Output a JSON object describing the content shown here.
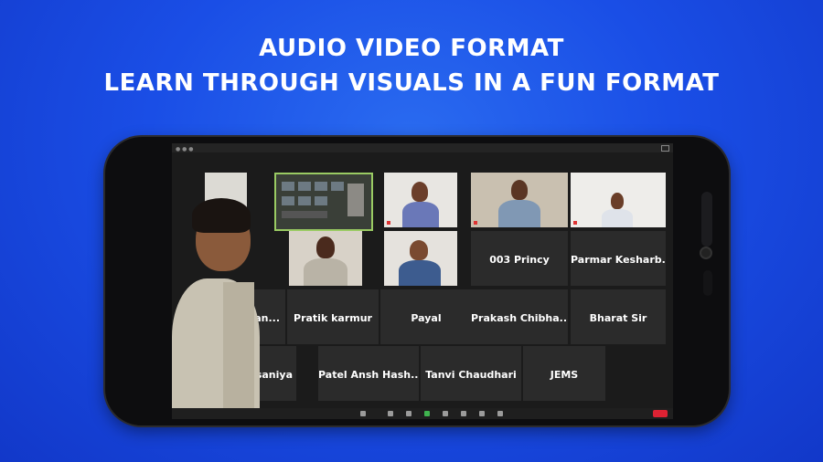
{
  "headline": {
    "line1": "AUDIO VIDEO FORMAT",
    "line2": "LEARN THROUGH VISUALS IN A FUN FORMAT"
  },
  "participants": [
    {
      "name": "003 Princy"
    },
    {
      "name": "Parmar  Kesharb..."
    },
    {
      "name": "...man..."
    },
    {
      "name": "Pratik karmur"
    },
    {
      "name": "Payal"
    },
    {
      "name": "Prakash  Chibha..."
    },
    {
      "name": "Bharat Sir"
    },
    {
      "name": "...ahida saniya"
    },
    {
      "name": "Patel  Ansh  Hash..."
    },
    {
      "name": "Tanvi Chaudhari"
    },
    {
      "name": "JEMS"
    }
  ],
  "icons": {
    "mute": "mic-icon",
    "video": "camera-icon",
    "participants": "people-icon",
    "chat": "chat-icon",
    "share": "share-screen-icon",
    "record": "record-icon",
    "reactions": "reaction-icon",
    "more": "more-icon",
    "end": "end-call-icon"
  },
  "colors": {
    "background": "#1a4ee6",
    "share_border": "#9acb63",
    "end_button": "#dd2233"
  }
}
